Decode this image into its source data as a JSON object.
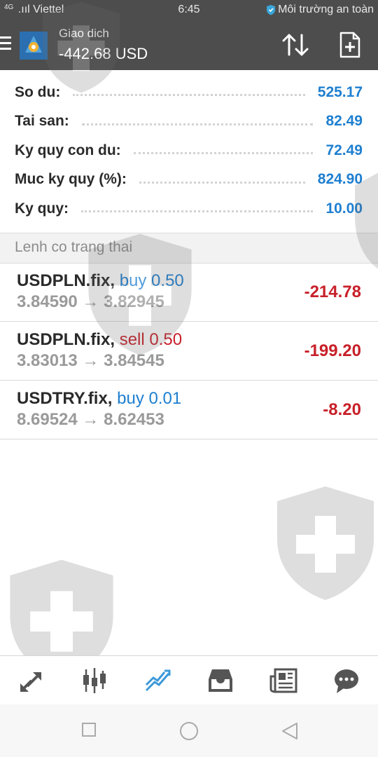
{
  "status_bar": {
    "signal_label": "4G",
    "carrier": "Viettel",
    "time": "6:45",
    "security_text": "Môi trường an toàn"
  },
  "header": {
    "title": "Giao dich",
    "balance": "-442.68 USD",
    "icons": [
      "menu-icon",
      "app-logo",
      "sort-icon",
      "new-order-icon"
    ]
  },
  "summary": [
    {
      "label": "So du:",
      "value": "525.17"
    },
    {
      "label": "Tai san:",
      "value": "82.49"
    },
    {
      "label": "Ky quy con du:",
      "value": "72.49"
    },
    {
      "label": "Muc ky quy (%):",
      "value": "824.90"
    },
    {
      "label": "Ky quy:",
      "value": "10.00"
    }
  ],
  "section_title": "Lenh co trang thai",
  "orders": [
    {
      "symbol": "USDPLN.fix,",
      "type": "buy 0.50",
      "side": "buy",
      "prices": "3.84590 → 3.82945",
      "profit": "-214.78"
    },
    {
      "symbol": "USDPLN.fix,",
      "type": "sell 0.50",
      "side": "sell",
      "prices": "3.83013 → 3.84545",
      "profit": "-199.20"
    },
    {
      "symbol": "USDTRY.fix,",
      "type": "buy 0.01",
      "side": "buy",
      "prices": "8.69524 → 8.62453",
      "profit": "-8.20"
    }
  ],
  "bottom_nav": [
    "quotes-icon",
    "chart-icon",
    "trade-icon",
    "history-icon",
    "news-icon",
    "chat-icon"
  ],
  "colors": {
    "header_bg": "#4d4d4d",
    "value_blue": "#1e7fd0",
    "loss_red": "#c8202a",
    "active_nav": "#3c9ad8"
  }
}
